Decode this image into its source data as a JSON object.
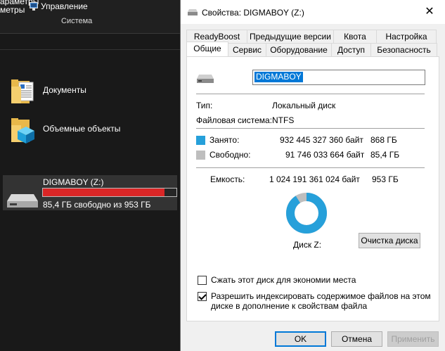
{
  "explorer": {
    "ribbon_line1": "араметры",
    "ribbon_line2": "метры",
    "manage_label": "Управление",
    "group_label": "Система",
    "folders": [
      {
        "label": "Документы"
      },
      {
        "label": "Объемные объекты"
      }
    ],
    "drive": {
      "name": "DIGMABOY (Z:)",
      "free_text": "85,4 ГБ свободно из 953 ГБ",
      "used_fraction": 0.91
    }
  },
  "dialog": {
    "title": "Свойства: DIGMABOY (Z:)",
    "close_glyph": "✕",
    "tabs_row1": [
      "ReadyBoost",
      "Предыдущие версии",
      "Квота",
      "Настройка"
    ],
    "tabs_row2": [
      "Общие",
      "Сервис",
      "Оборудование",
      "Доступ",
      "Безопасность"
    ],
    "active_tab": "Общие",
    "drive_name_value": "DIGMABOY",
    "type_label": "Тип:",
    "type_value": "Локальный диск",
    "fs_label": "Файловая система:",
    "fs_value": "NTFS",
    "used_label": "Занято:",
    "used_bytes": "932 445 327 360 байт",
    "used_gb": "868 ГБ",
    "free_label": "Свободно:",
    "free_bytes": "91 746 033 664 байт",
    "free_gb": "85,4 ГБ",
    "capacity_label": "Емкость:",
    "capacity_bytes": "1 024 191 361 024 байт",
    "capacity_gb": "953 ГБ",
    "disk_label": "Диск Z:",
    "cleanup_button": "Очистка диска",
    "compress_label": "Сжать этот диск для экономии места",
    "compress_checked": false,
    "index_label_line1": "Разрешить индексировать содержимое файлов на этом",
    "index_label_line2": "диске в дополнение к свойствам файла",
    "index_checked": true,
    "ok_button": "OK",
    "cancel_button": "Отмена",
    "apply_button": "Применить",
    "used_fraction": 0.91,
    "colors": {
      "used": "#26a0da",
      "free": "#bebebe",
      "selection": "#0078d7"
    }
  }
}
